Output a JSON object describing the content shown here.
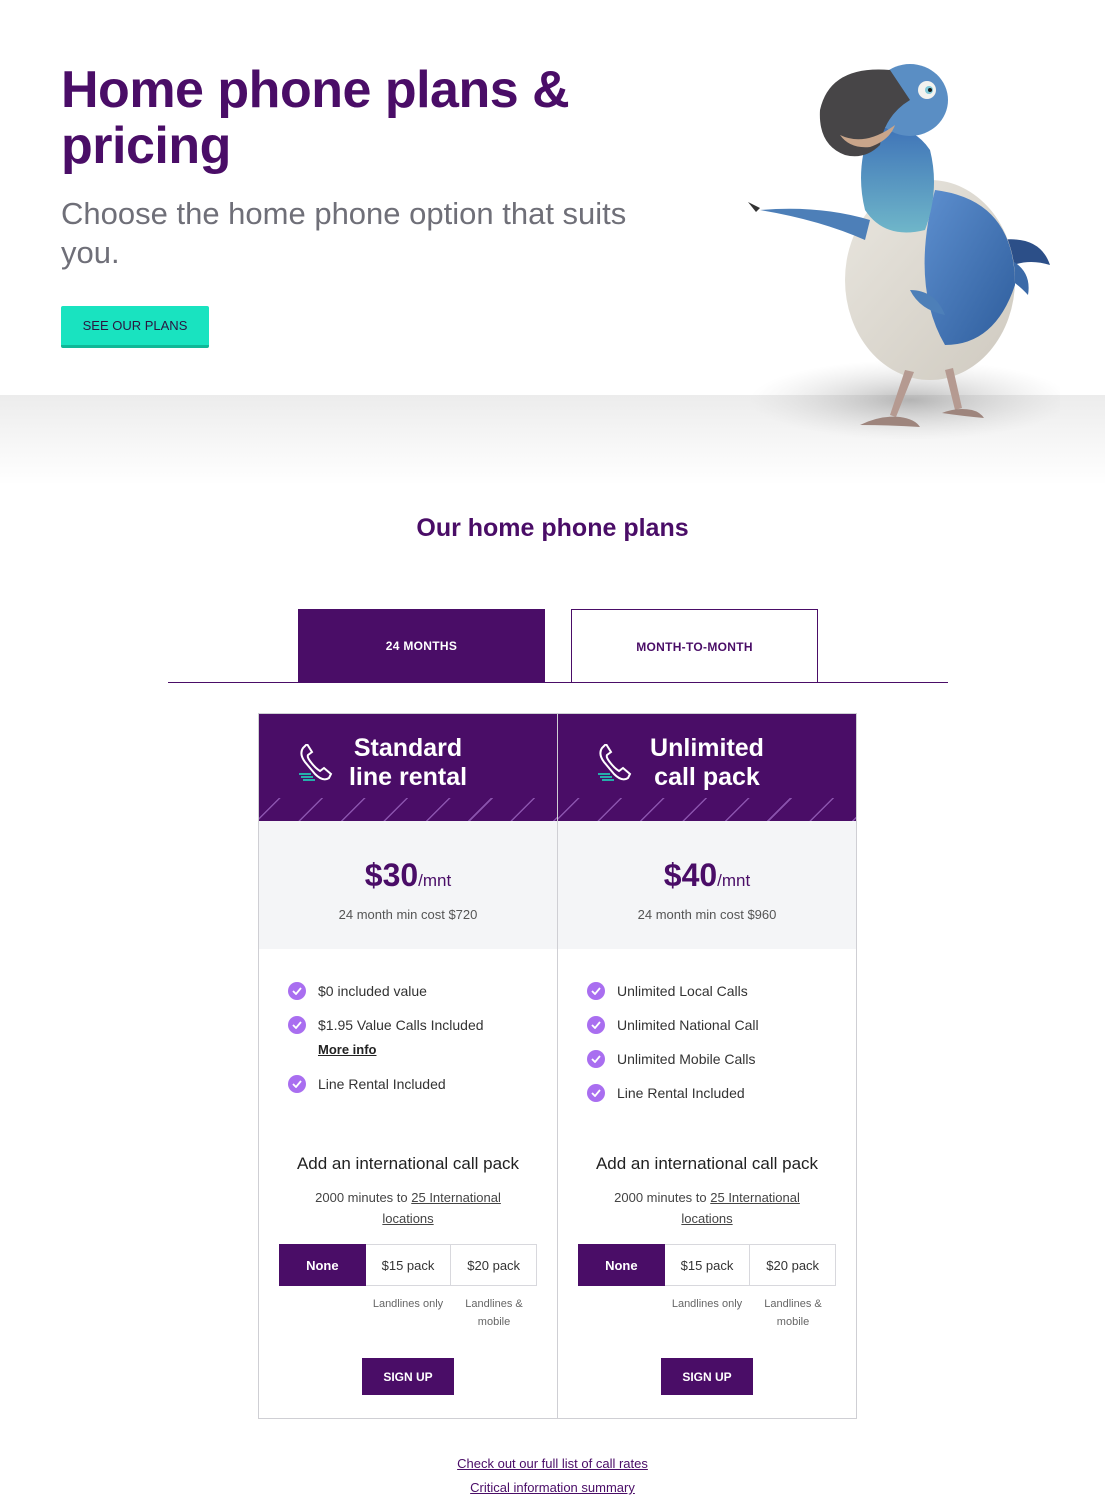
{
  "hero": {
    "title": "Home phone plans & pricing",
    "subtitle": "Choose the home phone option that suits you.",
    "cta": "SEE OUR PLANS",
    "mascot": "dodo-mascot"
  },
  "plans_section": {
    "title": "Our home phone plans",
    "tabs": [
      {
        "label": "24 MONTHS",
        "active": true
      },
      {
        "label": "MONTH-TO-MONTH",
        "active": false
      }
    ]
  },
  "plans": [
    {
      "title_line1": "Standard",
      "title_line2": "line rental",
      "icon": "phone-icon",
      "price": "$30",
      "unit": "/mnt",
      "min_cost": "24 month min cost $720",
      "features": [
        "$0 included value",
        "$1.95 Value Calls Included",
        "Line Rental Included"
      ],
      "more_info": "More info",
      "intl_title": "Add an international call pack",
      "intl_desc_prefix": "2000 minutes to ",
      "intl_desc_link": "25 International locations",
      "packs": [
        "None",
        "$15 pack",
        "$20 pack"
      ],
      "pack_notes": [
        "",
        "Landlines only",
        "Landlines & mobile"
      ],
      "signup": "SIGN UP"
    },
    {
      "title_line1": "Unlimited",
      "title_line2": "call pack",
      "icon": "phone-icon",
      "price": "$40",
      "unit": "/mnt",
      "min_cost": "24 month min cost $960",
      "features": [
        "Unlimited Local Calls",
        "Unlimited National Call",
        "Unlimited Mobile Calls",
        "Line Rental Included"
      ],
      "intl_title": "Add an international call pack",
      "intl_desc_prefix": "2000 minutes to ",
      "intl_desc_link": "25 International locations",
      "packs": [
        "None",
        "$15 pack",
        "$20 pack"
      ],
      "pack_notes": [
        "",
        "Landlines only",
        "Landlines & mobile"
      ],
      "signup": "SIGN UP"
    }
  ],
  "footer": {
    "link1": "Check out our full list of call rates",
    "link2": "Critical information summary"
  },
  "colors": {
    "brand_purple": "#4a0d67",
    "accent_teal": "#19e3c0",
    "check_purple": "#a96ef0"
  }
}
